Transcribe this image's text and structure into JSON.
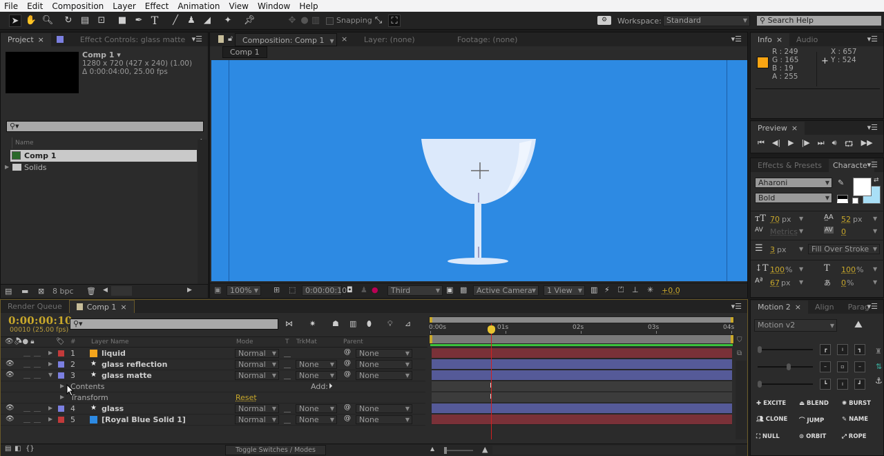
{
  "menu": [
    "File",
    "Edit",
    "Composition",
    "Layer",
    "Effect",
    "Animation",
    "View",
    "Window",
    "Help"
  ],
  "toolbar": {
    "snapping_label": "Snapping",
    "workspace_label": "Workspace:",
    "workspace_value": "Standard",
    "search_placeholder": "Search Help"
  },
  "project": {
    "tab_project": "Project",
    "tab_effect_controls": "Effect Controls: glass matte",
    "comp_name": "Comp 1 ▾",
    "comp_dims": "1280 x 720  (427 x 240) (1.00)",
    "comp_duration": "Δ 0:00:04:00, 25.00 fps",
    "col_name": "Name",
    "items": [
      {
        "name": "Comp 1",
        "icon": "composition-icon"
      },
      {
        "name": "Solids",
        "icon": "folder-icon"
      }
    ],
    "bpc": "8 bpc"
  },
  "viewer": {
    "tab_composition": "Composition: Comp 1",
    "tab_layer": "Layer: (none)",
    "tab_footage": "Footage: (none)",
    "breadcrumb": "Comp 1",
    "zoom": "100%",
    "timecode": "0:00:00:10",
    "resolution": "Third",
    "camera": "Active Camera",
    "views": "1 View",
    "exposure": "+0.0",
    "bg_color": "#2d8ae3"
  },
  "info": {
    "tab_info": "Info",
    "tab_audio": "Audio",
    "r": "R : 249",
    "g": "G : 165",
    "b": "B : 19",
    "a": "A : 255",
    "x": "X : 657",
    "y": "Y : 524",
    "swatch": "#f9a513"
  },
  "preview": {
    "tab": "Preview"
  },
  "character": {
    "tab_effects": "Effects & Presets",
    "tab_character": "Characte",
    "font": "Aharoni",
    "style": "Bold",
    "size": "70",
    "size_unit": "px",
    "leading": "52",
    "leading_unit": "px",
    "kerning": "Metrics",
    "tracking": "0",
    "stroke": "3",
    "stroke_unit": "px",
    "stroke_mode": "Fill Over Stroke",
    "vscale": "100",
    "hscale": "100",
    "baseline": "67",
    "tsume": "0",
    "pct": "%",
    "px": "px"
  },
  "motion": {
    "tab_motion": "Motion 2",
    "tab_align": "Align",
    "tab_parag": "Parag",
    "preset": "Motion v2",
    "sliders": [
      0.0,
      0.55,
      0.0
    ],
    "buttons": [
      "EXCITE",
      "BLEND",
      "BURST",
      "CLONE",
      "JUMP",
      "NAME",
      "NULL",
      "ORBIT",
      "ROPE"
    ]
  },
  "timeline": {
    "tab_render": "Render Queue",
    "tab_comp": "Comp 1",
    "timecode": "0:00:00:10",
    "frame_info": "00010 (25.00 fps)",
    "col_layer_name": "Layer Name",
    "col_mode": "Mode",
    "col_t": "T",
    "col_trkmat": "TrkMat",
    "col_parent": "Parent",
    "col_num": "#",
    "ruler": [
      "0:00s",
      "01s",
      "02s",
      "03s",
      "04s"
    ],
    "playhead_fraction": 0.1,
    "layers": [
      {
        "num": "1",
        "name": "liquid",
        "label_color": "#c23a3a",
        "icon_color": "#f4a51c",
        "mode": "Normal",
        "trkmat": "",
        "parent": "None",
        "bar_color": "#7a3138",
        "star": false,
        "eye": false
      },
      {
        "num": "2",
        "name": "glass reflection",
        "label_color": "#7b7fe0",
        "icon_color": "",
        "mode": "Normal",
        "trkmat": "None",
        "parent": "None",
        "bar_color": "#555a98",
        "star": true,
        "eye": true
      },
      {
        "num": "3",
        "name": "glass matte",
        "label_color": "#7b7fe0",
        "icon_color": "",
        "mode": "Normal",
        "trkmat": "None",
        "parent": "None",
        "bar_color": "#555a98",
        "star": true,
        "eye": true,
        "expanded": true
      },
      {
        "num": "4",
        "name": "glass",
        "label_color": "#7b7fe0",
        "icon_color": "",
        "mode": "Normal",
        "trkmat": "None",
        "parent": "None",
        "bar_color": "#555a98",
        "star": true,
        "eye": true
      },
      {
        "num": "5",
        "name": "[Royal Blue Solid 1]",
        "label_color": "#c23a3a",
        "icon_color": "#2d8ae3",
        "mode": "Normal",
        "trkmat": "None",
        "parent": "None",
        "bar_color": "#7a3138",
        "star": false,
        "eye": true
      }
    ],
    "contents_label": "Contents",
    "transform_label": "Transform",
    "add_label": "Add:",
    "reset_label": "Reset",
    "toggle_label": "Toggle Switches / Modes"
  }
}
